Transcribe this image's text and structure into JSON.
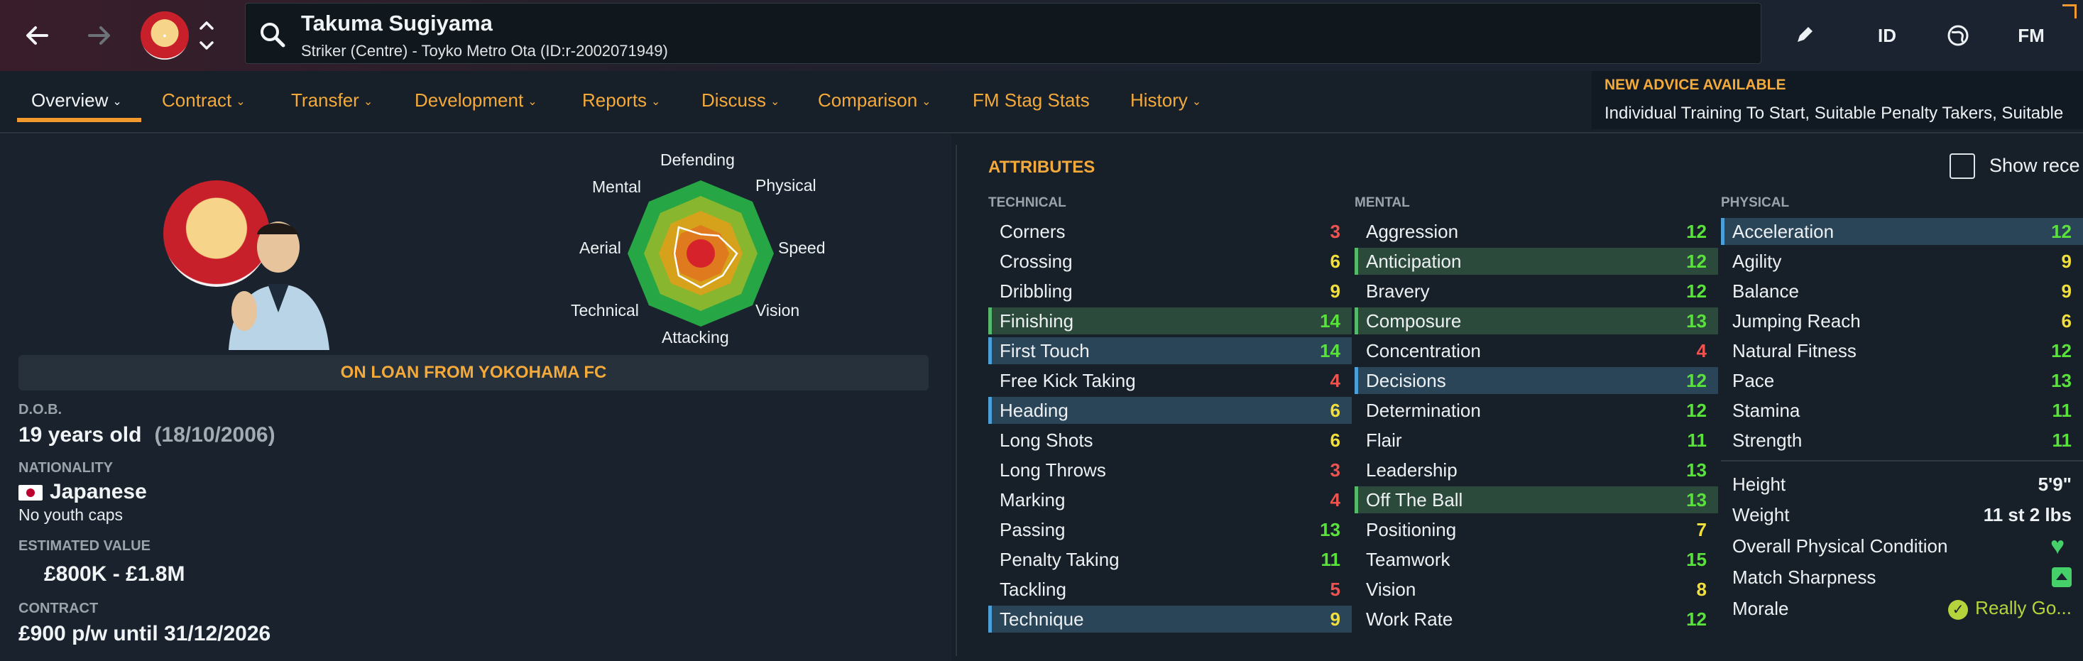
{
  "header": {
    "player_name": "Takuma Sugiyama",
    "subtitle": "Striker (Centre) - Toyko Metro Ota (ID:r-2002071949)",
    "icons": [
      "back-arrow-icon",
      "forward-arrow-icon",
      "club-crest-icon",
      "chevron-up-down-icon",
      "search-icon",
      "pencil-icon",
      "id-icon",
      "globe-icon",
      "fm-icon"
    ],
    "id_label": "ID",
    "fm_label": "FM"
  },
  "tabs": [
    {
      "label": "Overview",
      "active": true
    },
    {
      "label": "Contract"
    },
    {
      "label": "Transfer"
    },
    {
      "label": "Development"
    },
    {
      "label": "Reports"
    },
    {
      "label": "Discuss"
    },
    {
      "label": "Comparison"
    },
    {
      "label": "FM Stag Stats"
    },
    {
      "label": "History"
    }
  ],
  "advice": {
    "title": "NEW ADVICE AVAILABLE",
    "text": "Individual Training To Start, Suitable Penalty Takers, Suitable"
  },
  "radar": {
    "labels": {
      "defending": "Defending",
      "physical": "Physical",
      "speed": "Speed",
      "vision": "Vision",
      "attacking": "Attacking",
      "technical": "Technical",
      "aerial": "Aerial",
      "mental": "Mental"
    }
  },
  "loan_banner": "ON LOAN FROM YOKOHAMA FC",
  "info": {
    "dob_label": "D.O.B.",
    "age": "19 years old",
    "dob": "(18/10/2006)",
    "nationality_label": "NATIONALITY",
    "nationality": "Japanese",
    "youth_caps": "No youth caps",
    "value_label": "ESTIMATED VALUE",
    "value": "£800K - £1.8M",
    "contract_label": "CONTRACT",
    "contract": "£900 p/w until 31/12/2026"
  },
  "attributes": {
    "title": "ATTRIBUTES",
    "show_recent_label": "Show rece",
    "technical_label": "TECHNICAL",
    "mental_label": "MENTAL",
    "physical_label": "PHYSICAL",
    "technical": [
      {
        "name": "Corners",
        "value": "3"
      },
      {
        "name": "Crossing",
        "value": "6"
      },
      {
        "name": "Dribbling",
        "value": "9"
      },
      {
        "name": "Finishing",
        "value": "14",
        "hl": "green"
      },
      {
        "name": "First Touch",
        "value": "14",
        "hl": "blue"
      },
      {
        "name": "Free Kick Taking",
        "value": "4"
      },
      {
        "name": "Heading",
        "value": "6",
        "hl": "blue"
      },
      {
        "name": "Long Shots",
        "value": "6"
      },
      {
        "name": "Long Throws",
        "value": "3"
      },
      {
        "name": "Marking",
        "value": "4"
      },
      {
        "name": "Passing",
        "value": "13"
      },
      {
        "name": "Penalty Taking",
        "value": "11"
      },
      {
        "name": "Tackling",
        "value": "5"
      },
      {
        "name": "Technique",
        "value": "9",
        "hl": "blue"
      }
    ],
    "mental": [
      {
        "name": "Aggression",
        "value": "12"
      },
      {
        "name": "Anticipation",
        "value": "12",
        "hl": "green"
      },
      {
        "name": "Bravery",
        "value": "12"
      },
      {
        "name": "Composure",
        "value": "13",
        "hl": "green"
      },
      {
        "name": "Concentration",
        "value": "4"
      },
      {
        "name": "Decisions",
        "value": "12",
        "hl": "blue"
      },
      {
        "name": "Determination",
        "value": "12"
      },
      {
        "name": "Flair",
        "value": "11"
      },
      {
        "name": "Leadership",
        "value": "13"
      },
      {
        "name": "Off The Ball",
        "value": "13",
        "hl": "green"
      },
      {
        "name": "Positioning",
        "value": "7"
      },
      {
        "name": "Teamwork",
        "value": "15"
      },
      {
        "name": "Vision",
        "value": "8"
      },
      {
        "name": "Work Rate",
        "value": "12"
      }
    ],
    "physical": [
      {
        "name": "Acceleration",
        "value": "12",
        "hl": "blue"
      },
      {
        "name": "Agility",
        "value": "9"
      },
      {
        "name": "Balance",
        "value": "9"
      },
      {
        "name": "Jumping Reach",
        "value": "6"
      },
      {
        "name": "Natural Fitness",
        "value": "12"
      },
      {
        "name": "Pace",
        "value": "13"
      },
      {
        "name": "Stamina",
        "value": "11"
      },
      {
        "name": "Strength",
        "value": "11"
      }
    ]
  },
  "body": {
    "height_label": "Height",
    "height": "5'9\"",
    "weight_label": "Weight",
    "weight": "11 st 2 lbs",
    "condition_label": "Overall Physical Condition",
    "sharpness_label": "Match Sharpness",
    "morale_label": "Morale",
    "morale": "Really Go..."
  },
  "colors": {
    "accent": "#f4a93b",
    "val_red": "#ef5350",
    "val_yellow": "#f2df3a",
    "val_green": "#59e33a"
  }
}
